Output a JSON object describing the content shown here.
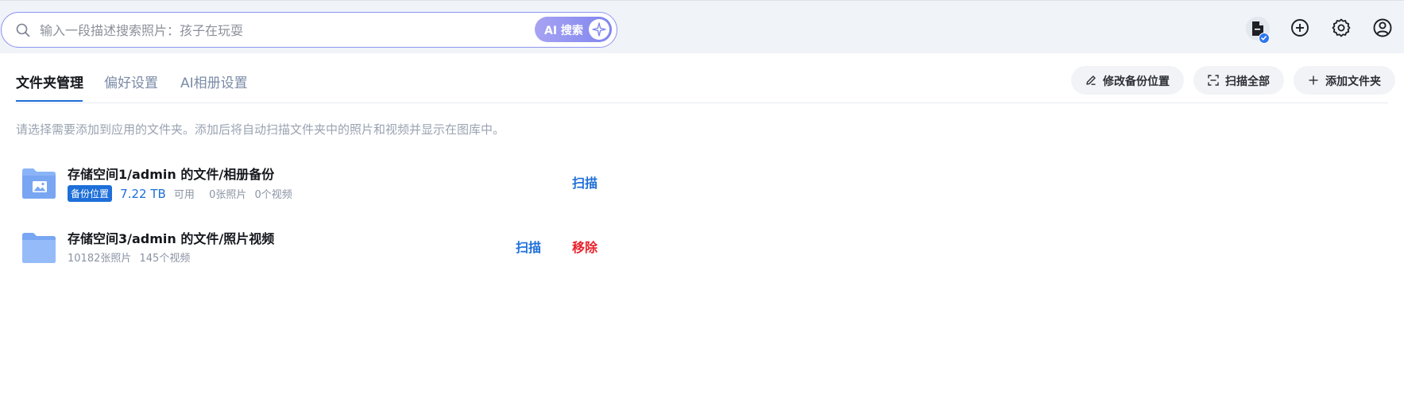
{
  "search": {
    "placeholder": "输入一段描述搜索照片：孩子在玩耍",
    "value": "",
    "ai_button_label": "AI 搜索"
  },
  "header_icons": [
    "document-sync-icon",
    "add-circle-icon",
    "gear-icon",
    "user-circle-icon"
  ],
  "tabs": [
    {
      "label": "文件夹管理",
      "active": true
    },
    {
      "label": "偏好设置",
      "active": false
    },
    {
      "label": "AI相册设置",
      "active": false
    }
  ],
  "actions": {
    "edit_backup": "修改备份位置",
    "scan_all": "扫描全部",
    "add_folder": "添加文件夹"
  },
  "description": "请选择需要添加到应用的文件夹。添加后将自动扫描文件夹中的照片和视频并显示在图库中。",
  "folders": [
    {
      "name": "存储空间1/admin 的文件/相册备份",
      "badge": "备份位置",
      "capacity": "7.22 TB",
      "available_label": "可用",
      "photos": "0张照片",
      "videos": "0个视频",
      "scan_label": "扫描"
    },
    {
      "name": "存储空间3/admin 的文件/照片视频",
      "photos": "10182张照片",
      "videos": "145个视频",
      "scan_label": "扫描",
      "remove_label": "移除"
    }
  ],
  "colors": {
    "accent": "#1e6fd9",
    "danger": "#e8202a",
    "folder": "#8ab4f8",
    "topbar_bg": "#f0f3f8"
  }
}
